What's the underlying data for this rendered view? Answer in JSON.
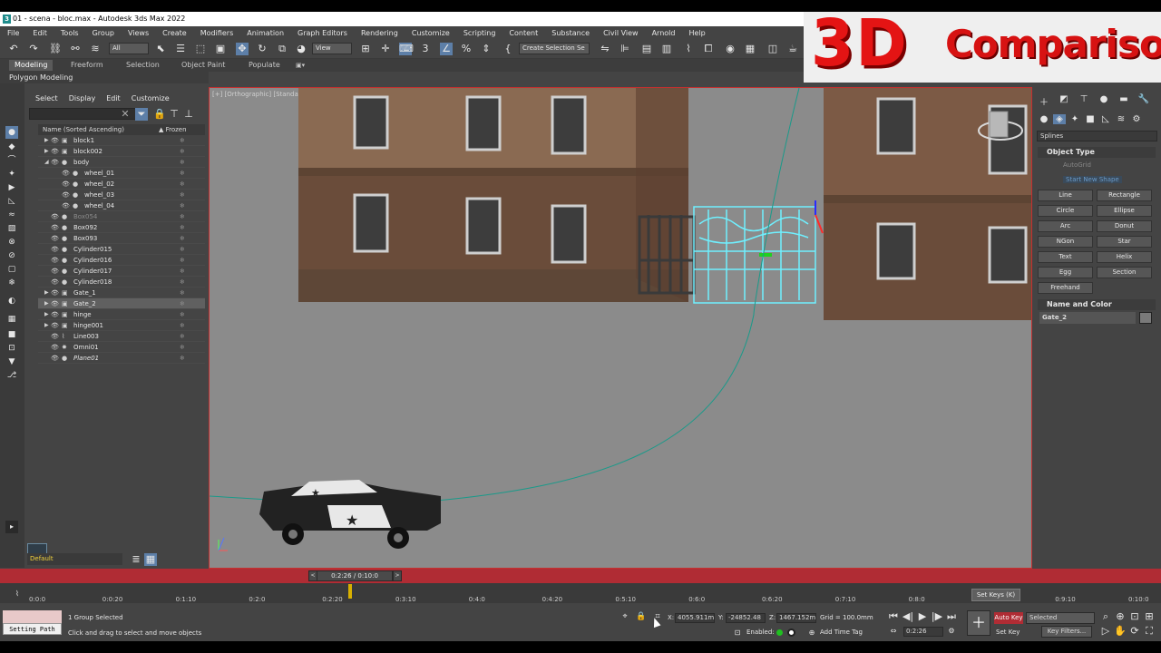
{
  "window": {
    "title": "01 - scena - bloc.max - Autodesk 3ds Max 2022"
  },
  "menu": [
    "File",
    "Edit",
    "Tools",
    "Group",
    "Views",
    "Create",
    "Modifiers",
    "Animation",
    "Graph Editors",
    "Rendering",
    "Customize",
    "Scripting",
    "Content",
    "Substance",
    "Civil View",
    "Arnold",
    "Help"
  ],
  "toolbar": {
    "filter": "All",
    "ref_coord": "View",
    "selection_set": "Create Selection Se"
  },
  "ribbon": {
    "tabs": [
      "Modeling",
      "Freeform",
      "Selection",
      "Object Paint",
      "Populate"
    ],
    "active": "Modeling",
    "sub": "Polygon Modeling"
  },
  "banner": {
    "big": "3D",
    "word": "Comparison"
  },
  "scene_explorer": {
    "menu": [
      "Select",
      "Display",
      "Edit",
      "Customize"
    ],
    "header_name": "Name (Sorted Ascending)",
    "header_frozen": "▲ Frozen",
    "rows": [
      {
        "name": "block1",
        "level": 0,
        "expand": "▶",
        "type": "grp"
      },
      {
        "name": "block002",
        "level": 0,
        "expand": "▶",
        "type": "grp"
      },
      {
        "name": "body",
        "level": 0,
        "expand": "◢",
        "type": "obj"
      },
      {
        "name": "wheel_01",
        "level": 1,
        "expand": "",
        "type": "obj"
      },
      {
        "name": "wheel_02",
        "level": 1,
        "expand": "",
        "type": "obj"
      },
      {
        "name": "wheel_03",
        "level": 1,
        "expand": "",
        "type": "obj"
      },
      {
        "name": "wheel_04",
        "level": 1,
        "expand": "",
        "type": "obj"
      },
      {
        "name": "Box054",
        "level": 0,
        "expand": "",
        "type": "obj",
        "dim": true
      },
      {
        "name": "Box092",
        "level": 0,
        "expand": "",
        "type": "obj"
      },
      {
        "name": "Box093",
        "level": 0,
        "expand": "",
        "type": "obj"
      },
      {
        "name": "Cylinder015",
        "level": 0,
        "expand": "",
        "type": "obj"
      },
      {
        "name": "Cylinder016",
        "level": 0,
        "expand": "",
        "type": "obj"
      },
      {
        "name": "Cylinder017",
        "level": 0,
        "expand": "",
        "type": "obj"
      },
      {
        "name": "Cylinder018",
        "level": 0,
        "expand": "",
        "type": "obj"
      },
      {
        "name": "Gate_1",
        "level": 0,
        "expand": "▶",
        "type": "grp"
      },
      {
        "name": "Gate_2",
        "level": 0,
        "expand": "▶",
        "type": "grp",
        "selected": true
      },
      {
        "name": "hinge",
        "level": 0,
        "expand": "▶",
        "type": "grp"
      },
      {
        "name": "hinge001",
        "level": 0,
        "expand": "▶",
        "type": "grp"
      },
      {
        "name": "Line003",
        "level": 0,
        "expand": "",
        "type": "shape"
      },
      {
        "name": "Omni01",
        "level": 0,
        "expand": "",
        "type": "light"
      },
      {
        "name": "Plane01",
        "level": 0,
        "expand": "",
        "type": "obj",
        "italic": true
      }
    ]
  },
  "layer": {
    "value": "Default"
  },
  "viewport": {
    "label": "[+] [Orthographic] [Standard] [Default Shading]"
  },
  "command_panel": {
    "category": "Splines",
    "object_type": "Object Type",
    "autogrid": "AutoGrid",
    "start_new_shape": "Start New Shape",
    "buttons": [
      "Line",
      "Rectangle",
      "Circle",
      "Ellipse",
      "Arc",
      "Donut",
      "NGon",
      "Star",
      "Text",
      "Helix",
      "Egg",
      "Section",
      "Freehand"
    ],
    "name_color": "Name and Color",
    "object_name": "Gate_2"
  },
  "timeline": {
    "frame": "0:2:26 / 0:10:0",
    "ticks": [
      "0:0:0",
      "0:0:20",
      "0:1:10",
      "0:2:0",
      "0:2:20",
      "0:3:10",
      "0:4:0",
      "0:4:20",
      "0:5:10",
      "0:6:0",
      "0:6:20",
      "0:7:10",
      "0:8:0",
      "0:8:20",
      "0:9:10",
      "0:10:0"
    ]
  },
  "status": {
    "setting_path": "Setting Path",
    "selection": "1 Group Selected",
    "hint": "Click and drag to select and move objects",
    "x_label": "X:",
    "x": "4055.911m",
    "y_label": "Y:",
    "y": "-24852.48",
    "z_label": "Z:",
    "z": "1467.152m",
    "grid": "Grid = 100.0mm",
    "enabled": "Enabled:",
    "add_time_tag": "Add Time Tag",
    "auto_key": "Auto Key",
    "selected": "Selected",
    "set_key": "Set Key",
    "key_filters": "Key Filters...",
    "current_time": "0:2:26",
    "tooltip": "Set Keys  (K)"
  },
  "colors": {
    "accent_red": "#b02c34",
    "selection_cyan": "#6ff0ff",
    "banner_red": "#e41414"
  }
}
